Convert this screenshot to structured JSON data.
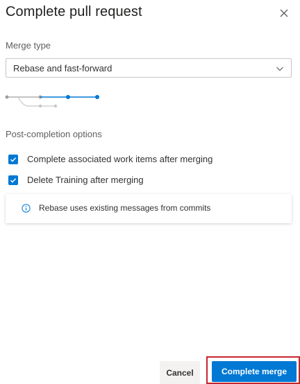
{
  "dialog": {
    "title": "Complete pull request",
    "close_icon": "close-icon"
  },
  "merge_type": {
    "label": "Merge type",
    "selected": "Rebase and fast-forward",
    "chevron_icon": "chevron-down-icon"
  },
  "options": {
    "section_label": "Post-completion options",
    "items": [
      {
        "label": "Complete associated work items after merging",
        "checked": true
      },
      {
        "label": "Delete Training after merging",
        "checked": true
      }
    ]
  },
  "info": {
    "icon": "info-icon",
    "text": "Rebase uses existing messages from commits"
  },
  "footer": {
    "cancel_label": "Cancel",
    "primary_label": "Complete merge"
  },
  "colors": {
    "accent": "#0078d4",
    "highlight_border": "#c4262e",
    "graph_grey": "#a19f9d"
  }
}
